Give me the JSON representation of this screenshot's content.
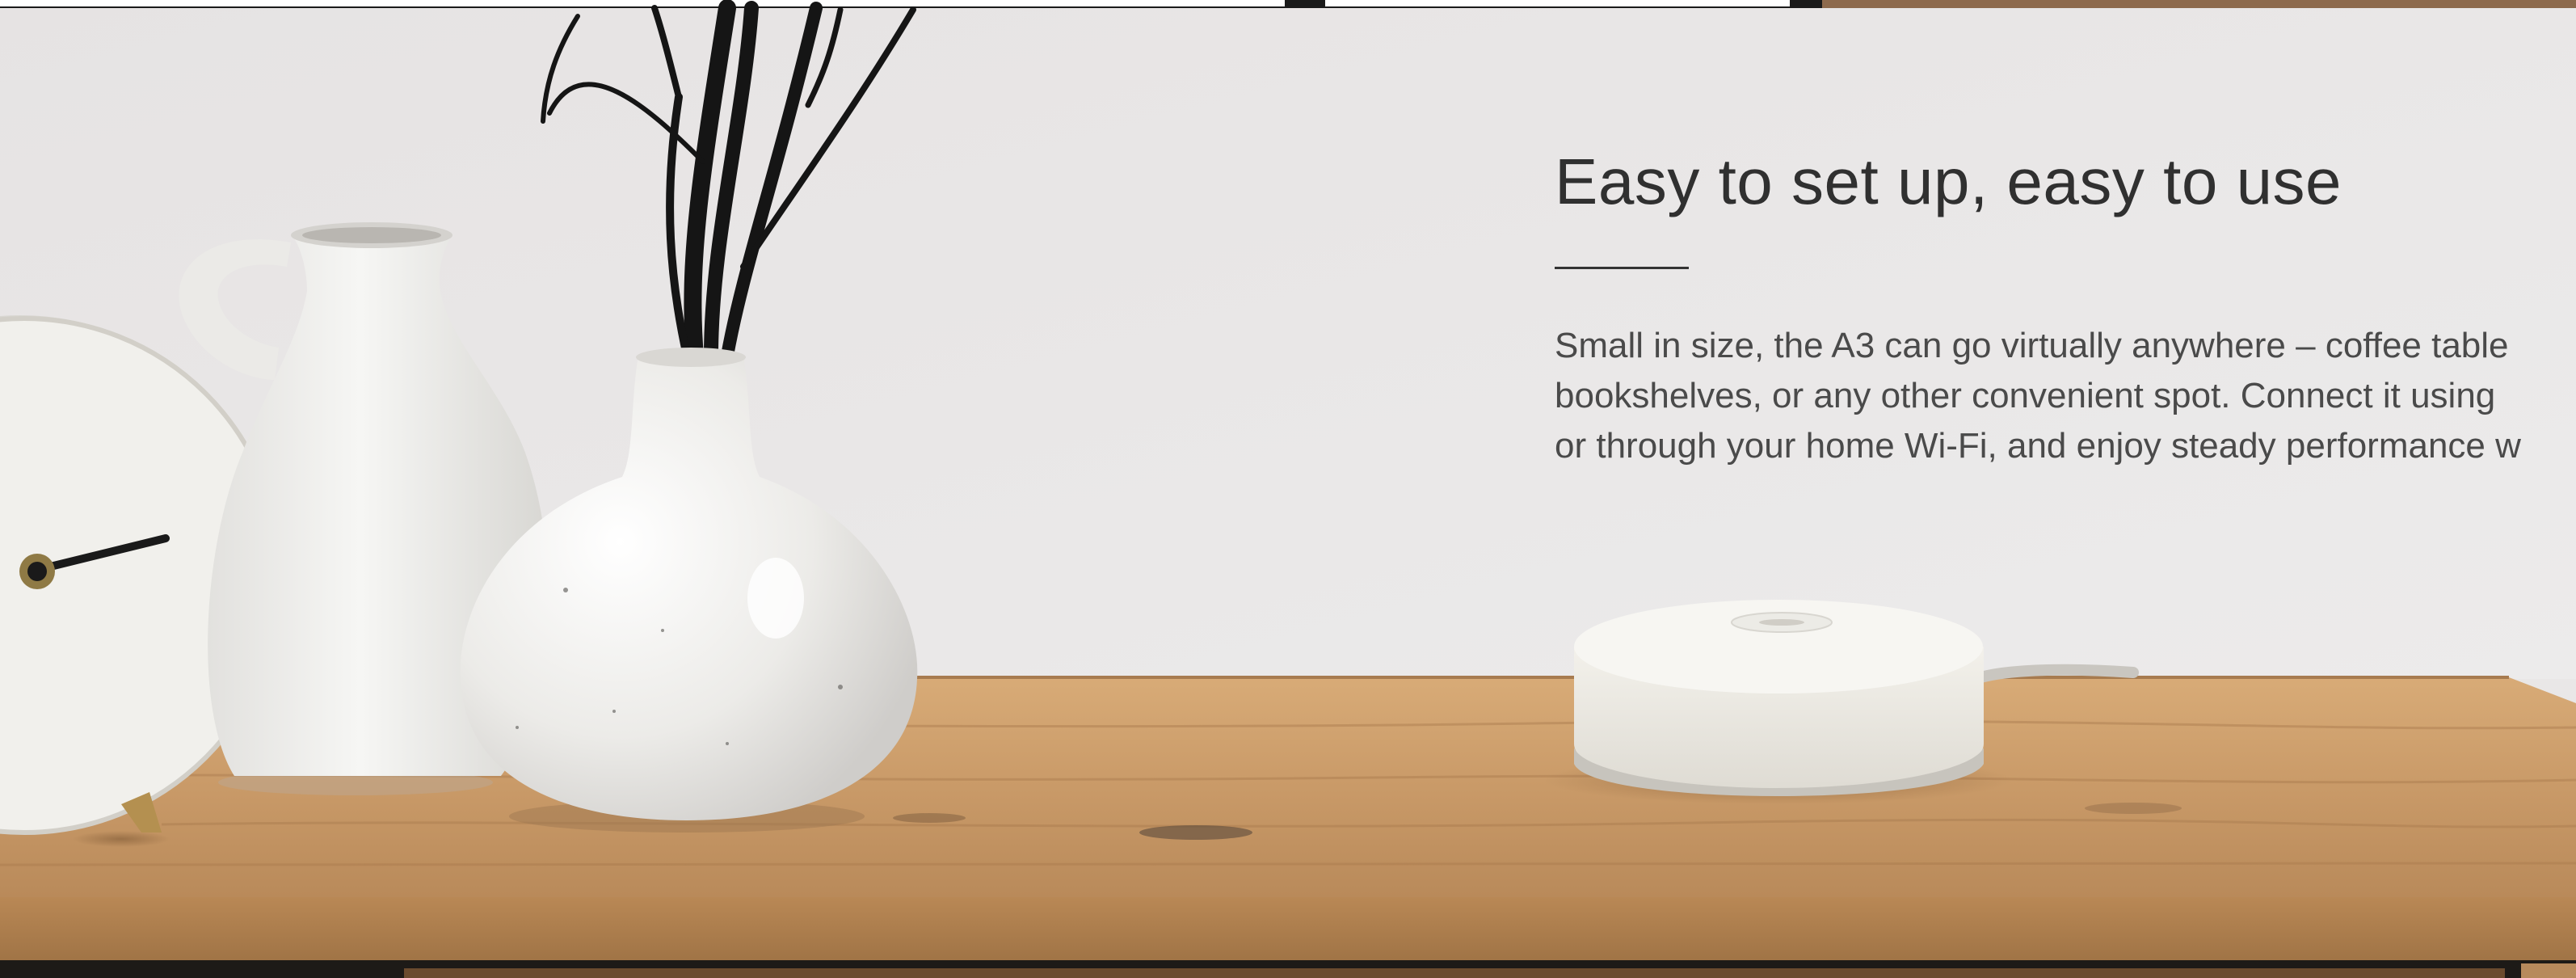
{
  "section": {
    "heading": "Easy to set up, easy to use",
    "body_lines": [
      "Small in size, the A3 can go virtually anywhere – coffee table",
      "bookshelves, or any other convenient spot. Connect it using",
      "or through your home Wi-Fi, and enjoy steady performance w"
    ]
  },
  "colors": {
    "wall": "#e9e7e7",
    "tabletop": "#c99a68",
    "device": "#f2f0ea",
    "heading_text": "#303030"
  }
}
